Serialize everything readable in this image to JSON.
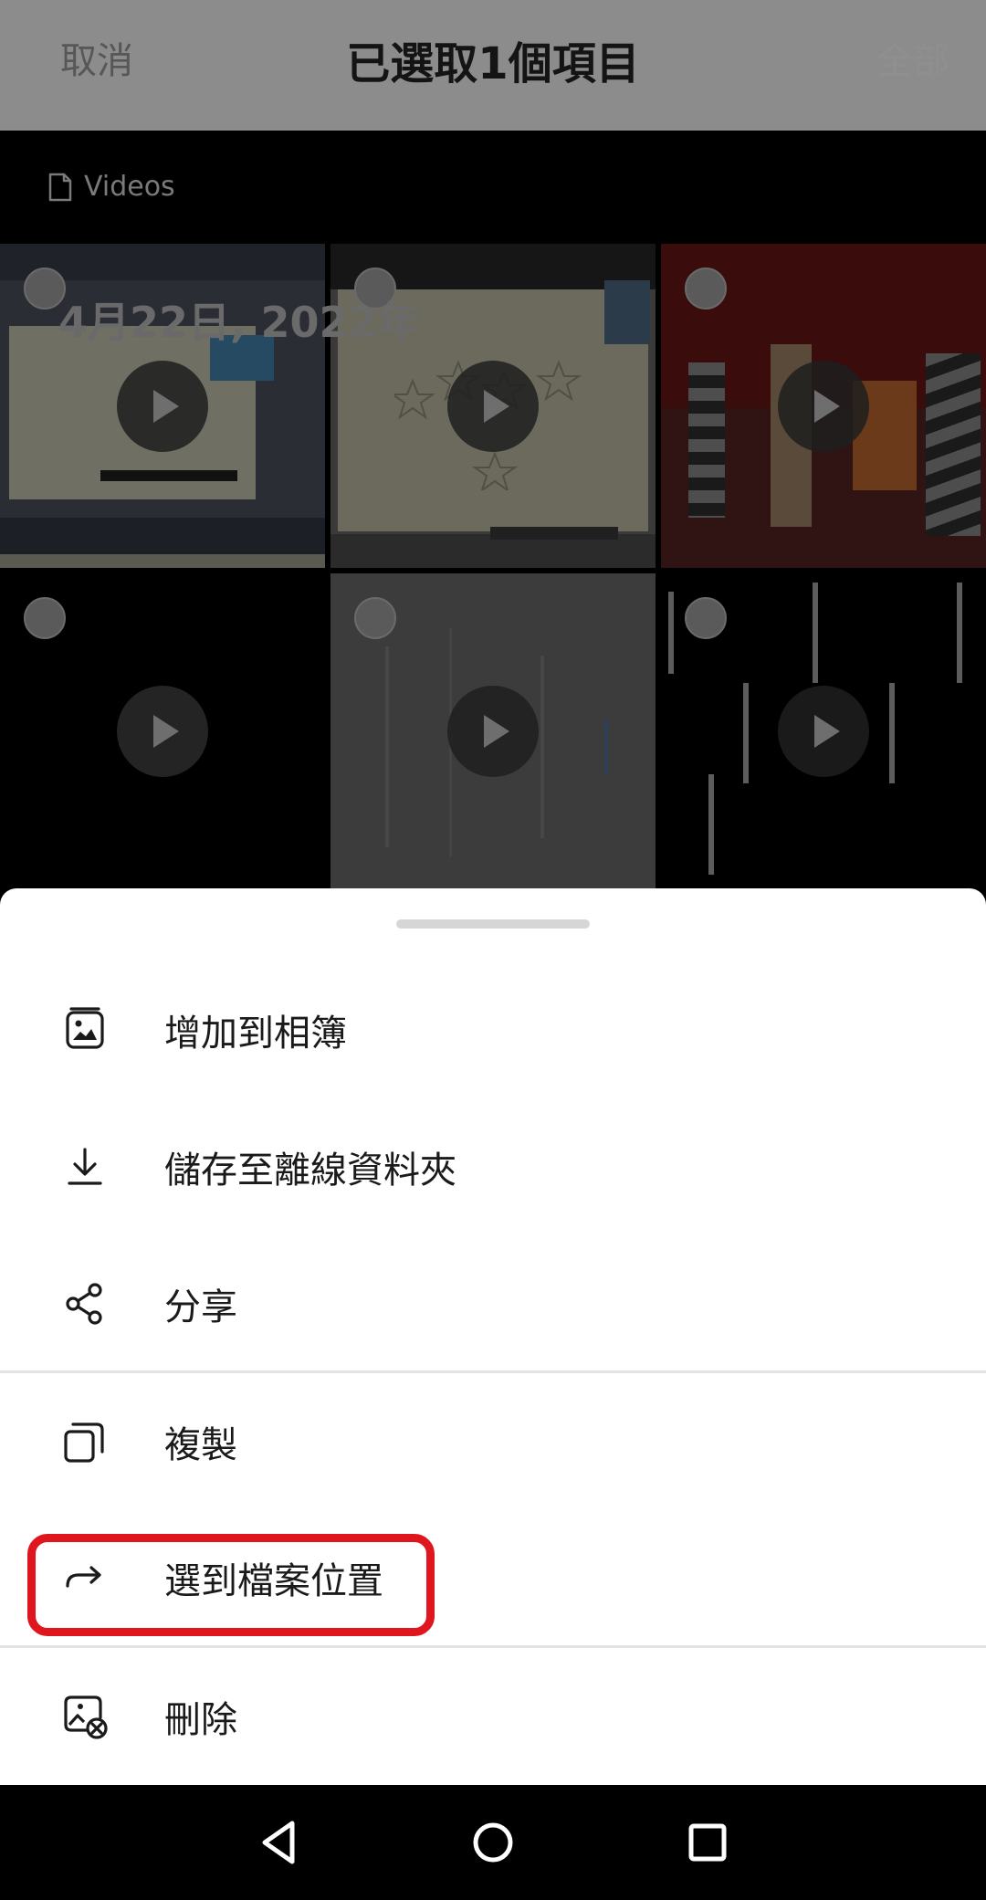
{
  "header": {
    "cancel_label": "取消",
    "title": "已選取1個項目",
    "right_action_label": "全部"
  },
  "folder": {
    "icon": "file-icon",
    "label": "Videos"
  },
  "grid": {
    "date_label": "4月22日, 2022年",
    "thumbnails": [
      {
        "kind": "screen-recording"
      },
      {
        "kind": "whiteboard-stars"
      },
      {
        "kind": "stage-performance"
      },
      {
        "kind": "black-countdown"
      },
      {
        "kind": "gray-glitch"
      },
      {
        "kind": "black-light-bars"
      }
    ]
  },
  "sheet": {
    "items": [
      {
        "label": "增加到相簿",
        "icon": "add-to-album-icon"
      },
      {
        "label": "儲存至離線資料夾",
        "icon": "download-icon"
      },
      {
        "label": "分享",
        "icon": "share-icon"
      },
      {
        "label": "複製",
        "icon": "copy-icon"
      },
      {
        "label": "選到檔案位置",
        "icon": "redirect-arrow-icon"
      },
      {
        "label": "刪除",
        "icon": "delete-image-icon"
      }
    ],
    "highlight_color": "#e0161e"
  },
  "navbar": {
    "buttons": [
      "back-triangle-icon",
      "home-circle-icon",
      "recents-square-icon"
    ]
  }
}
